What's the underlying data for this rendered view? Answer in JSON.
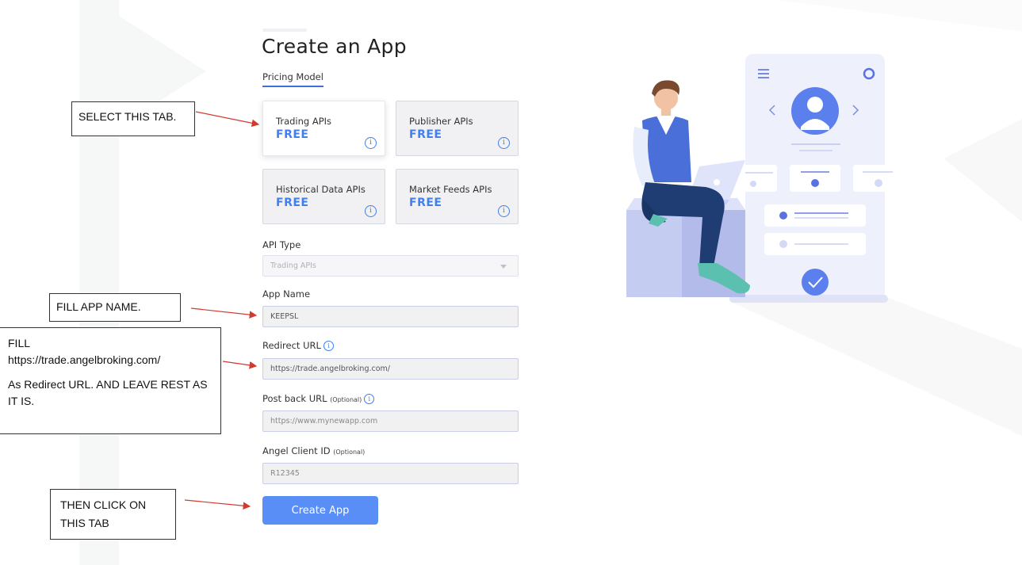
{
  "page": {
    "title": "Create an App",
    "pricing_tab": "Pricing Model"
  },
  "pricing_cards": [
    {
      "label": "Trading APIs",
      "price": "FREE",
      "selected": true
    },
    {
      "label": "Publisher APIs",
      "price": "FREE",
      "selected": false
    },
    {
      "label": "Historical Data APIs",
      "price": "FREE",
      "selected": false
    },
    {
      "label": "Market Feeds APIs",
      "price": "FREE",
      "selected": false
    }
  ],
  "form": {
    "api_type_label": "API Type",
    "api_type_value": "Trading APIs",
    "app_name_label": "App Name",
    "app_name_value": "KEEPSL",
    "redirect_label": "Redirect URL",
    "redirect_value": "https://trade.angelbroking.com/",
    "postback_label": "Post back URL",
    "postback_optional": "(Optional)",
    "postback_placeholder": "https://www.mynewapp.com",
    "client_id_label": "Angel Client ID",
    "client_id_optional": "(Optional)",
    "client_id_placeholder": "R12345",
    "submit_label": "Create App"
  },
  "annotations": {
    "select_tab": "SELECT THIS TAB.",
    "fill_app_name": "FILL APP NAME.",
    "fill_redirect_line1": "FILL",
    "fill_redirect_line2": "https://trade.angelbroking.com/",
    "fill_redirect_line3": "As Redirect URL. AND LEAVE REST AS IT IS.",
    "click_line1": "THEN CLICK ON",
    "click_line2": "THIS TAB"
  },
  "icons": {
    "info": "info-circle-icon",
    "caret": "chevron-down-icon",
    "menu": "hamburger-menu-icon",
    "settings": "gear-icon",
    "check": "check-icon"
  },
  "colors": {
    "accent": "#5a8ef7",
    "price": "#3f80f0",
    "arrow": "#d23a2e"
  }
}
